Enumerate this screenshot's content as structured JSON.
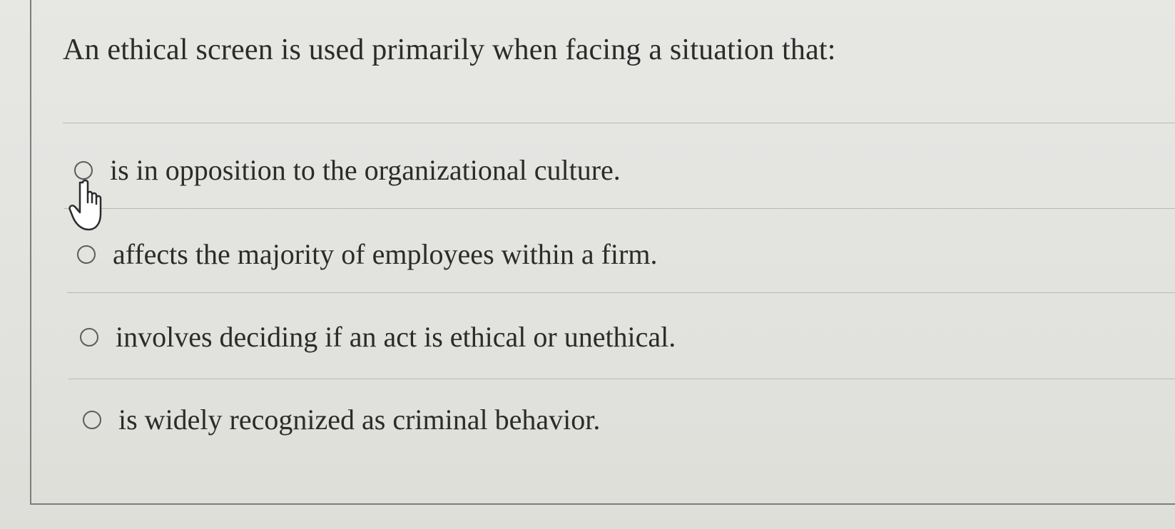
{
  "question": {
    "text": "An ethical screen is used primarily when facing a situation that:"
  },
  "options": [
    {
      "label": "is in opposition to the organizational culture.",
      "selected": false
    },
    {
      "label": "affects the majority of employees within a firm.",
      "selected": false
    },
    {
      "label": "involves deciding if an act is ethical or unethical.",
      "selected": false
    },
    {
      "label": "is widely recognized as criminal behavior.",
      "selected": false
    }
  ],
  "cursor": {
    "icon": "hand-pointer-icon"
  }
}
